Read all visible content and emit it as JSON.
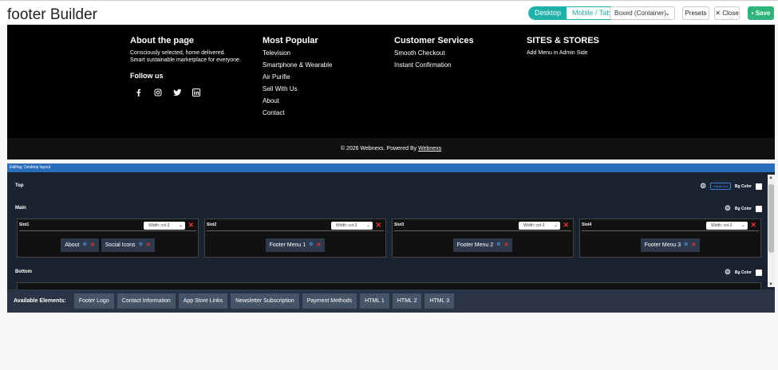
{
  "header": {
    "title": "footer Builder",
    "view_desktop": "Desktop",
    "view_mobile": "Mobile / Tablet",
    "layout_select": "Boxed (Container)",
    "presets_label": "Presets",
    "close_label": "Close",
    "save_label": "Save",
    "accent_color": "#20b2aa",
    "save_color": "#2fb57a"
  },
  "footer_preview": {
    "about": {
      "title": "About the page",
      "description": "Consciously selected, home delivered. Smart sustainable marketplace for everyone.",
      "follow_title": "Follow us",
      "social_icons": [
        "facebook-icon",
        "instagram-icon",
        "twitter-icon",
        "linkedin-icon"
      ]
    },
    "popular": {
      "title": "Most Popular",
      "links": [
        "Television",
        "Smartphone & Wearable",
        "Air Purifie",
        "Sell With Us",
        "About",
        "Contact"
      ]
    },
    "customer": {
      "title": "Customer Services",
      "links": [
        "Smooth Checkout",
        "Instant Confirmation"
      ]
    },
    "sites": {
      "title": "SITES & STORES",
      "note": "Add Menu in Admin Side"
    },
    "copyright": "© 2026 Webnexs. Powered By ",
    "copyright_link": "Webnexs"
  },
  "editor": {
    "editing_label": "Editing: Desktop layout",
    "rows": {
      "top": "Top",
      "main": "Main",
      "bottom": "Bottom"
    },
    "add_col_label": "Add Col",
    "bg_color_label": "Bg Color",
    "slots": [
      {
        "name": "Slot1",
        "width": "Width: col-3",
        "items": [
          "About",
          "Social Icons"
        ]
      },
      {
        "name": "Slot2",
        "width": "Width: col-3",
        "items": [
          "Footer Menu 1"
        ]
      },
      {
        "name": "Slot3",
        "width": "Width: col-3",
        "items": [
          "Footer Menu 2"
        ]
      },
      {
        "name": "Slot4",
        "width": "Width: col-3",
        "items": [
          "Footer Menu 3"
        ]
      }
    ]
  },
  "available": {
    "label": "Available Elements:",
    "elements": [
      "Footer Logo",
      "Contact Information",
      "App Store Links",
      "Newsletter Subscription",
      "Payment Methods",
      "HTML 1",
      "HTML 2",
      "HTML 3"
    ]
  }
}
